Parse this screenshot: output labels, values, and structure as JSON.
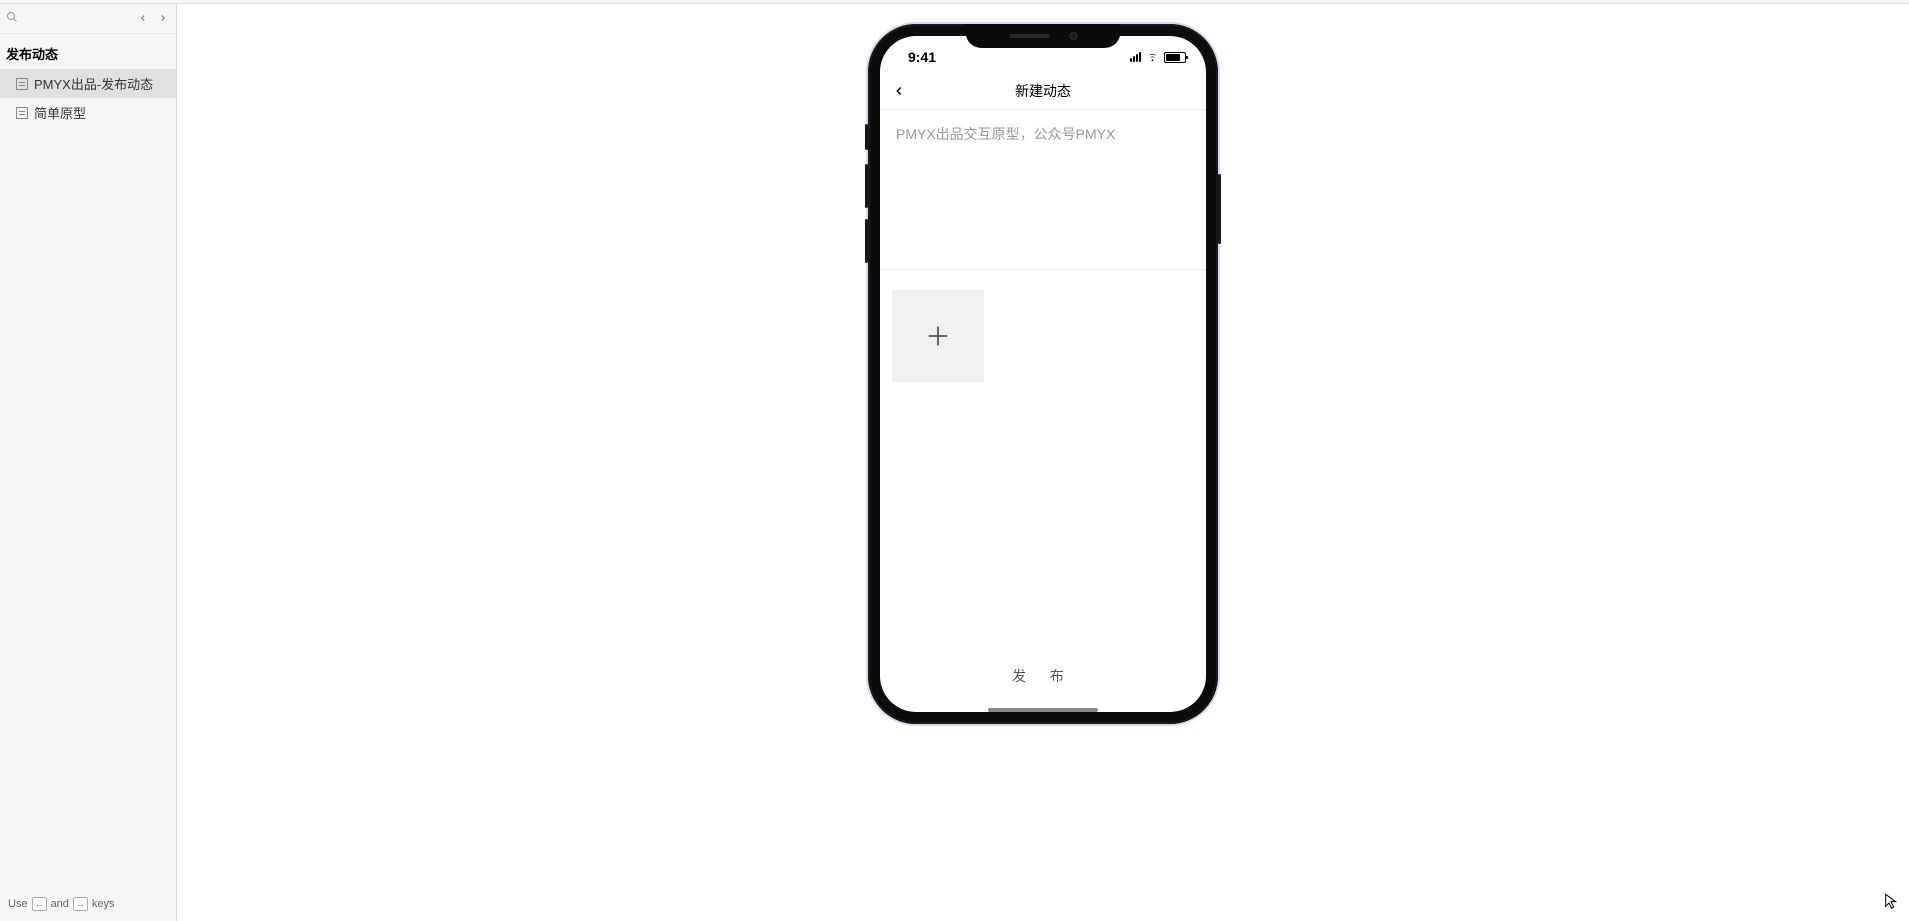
{
  "sidebar": {
    "group_title": "发布动态",
    "items": [
      {
        "label": "PMYX出品-发布动态",
        "active": true
      },
      {
        "label": "简单原型",
        "active": false
      }
    ],
    "footer": {
      "prefix": "Use",
      "key1": "←",
      "mid": "and",
      "key2": "→",
      "suffix": "keys"
    }
  },
  "phone": {
    "status_time": "9:41",
    "nav_title": "新建动态",
    "placeholder": "PMYX出品交互原型，公众号PMYX",
    "publish_label": "发 布"
  }
}
